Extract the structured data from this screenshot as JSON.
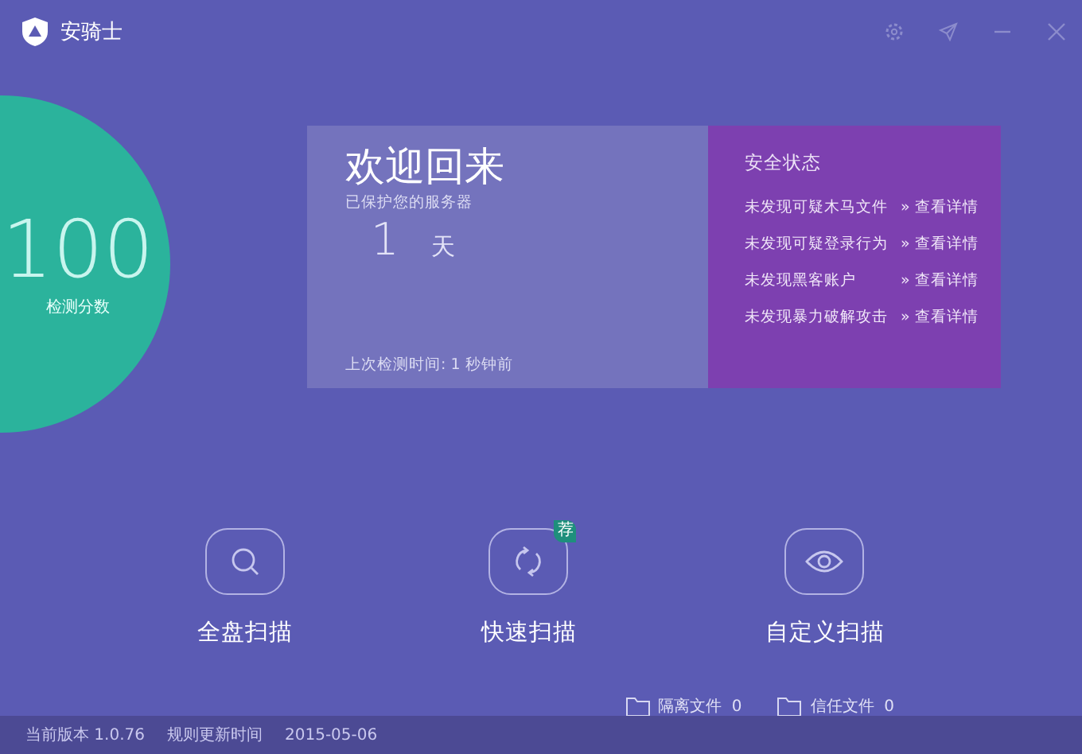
{
  "window": {
    "title": "安骑士"
  },
  "score": {
    "value": "100",
    "label": "检测分数"
  },
  "welcome": {
    "title": "欢迎回来",
    "subtitle": "已保护您的服务器",
    "days": "1",
    "unit": "天",
    "last_check": "上次检测时间: 1 秒钟前"
  },
  "security": {
    "title": "安全状态",
    "items": [
      {
        "text": "未发现可疑木马文件",
        "link": "» 查看详情"
      },
      {
        "text": "未发现可疑登录行为",
        "link": "» 查看详情"
      },
      {
        "text": "未发现黑客账户",
        "link": "» 查看详情"
      },
      {
        "text": "未发现暴力破解攻击",
        "link": "» 查看详情"
      }
    ]
  },
  "scans": [
    {
      "kind": "search",
      "label": "全盘扫描"
    },
    {
      "kind": "refresh",
      "label": "快速扫描",
      "badge": "荐"
    },
    {
      "kind": "eye",
      "label": "自定义扫描"
    }
  ],
  "files": [
    {
      "label": "隔离文件",
      "count": "0"
    },
    {
      "label": "信任文件",
      "count": "0"
    }
  ],
  "status_bar": {
    "version": "当前版本 1.0.76",
    "update_label": "规则更新时间",
    "update_date": "2015-05-06"
  }
}
